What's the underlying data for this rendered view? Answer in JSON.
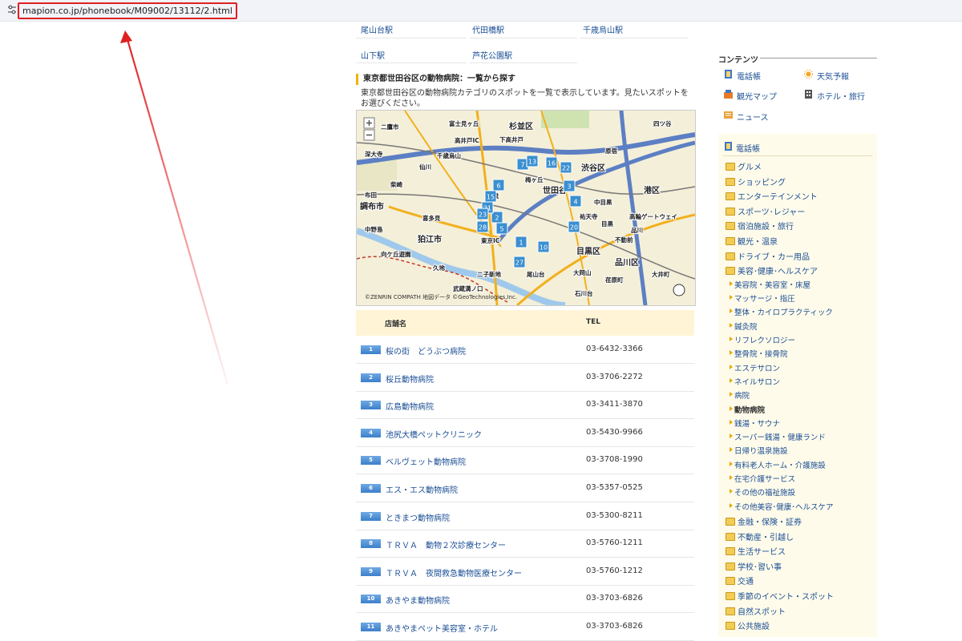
{
  "address_bar": {
    "url": "mapion.co.jp/phonebook/M09002/13112/2.html"
  },
  "stations": [
    {
      "label": "尾山台駅"
    },
    {
      "label": "代田橋駅"
    },
    {
      "label": "千歳烏山駅"
    },
    {
      "label": "山下駅"
    },
    {
      "label": "芦花公園駅"
    }
  ],
  "section": {
    "title": "東京都世田谷区の動物病院：一覧から探す",
    "description": "東京都世田谷区の動物病院カテゴリのスポットを一覧で表示しています。見たいスポットをお選びください。"
  },
  "map": {
    "copyright": "©ZENRIN COMPATH 地図データ ©GeoTechnologies,Inc.",
    "labels": [
      "二鷹市",
      "富士見ヶ丘",
      "杉並区",
      "四ツ谷",
      "高井戸IC",
      "深大寺",
      "千歳烏山",
      "下高井戸",
      "原宿",
      "仙川",
      "梅ヶ丘",
      "渋谷区",
      "柴崎",
      "千歳",
      "世田谷",
      "港区",
      "布田",
      "中目黒",
      "調布市",
      "喜多見",
      "祐天寺",
      "目黒",
      "中野島",
      "品川",
      "狛江市",
      "東京IC",
      "不動前",
      "向ケ丘遊園",
      "目黒区",
      "久地",
      "品川区",
      "二子新地",
      "尾山台",
      "大岡山",
      "武蔵溝ノ口",
      "荏原町",
      "石川台",
      "大井町",
      "高輪ゲートウェイ"
    ],
    "markers": [
      "1",
      "2",
      "3",
      "4",
      "5",
      "6",
      "7",
      "10",
      "13",
      "15",
      "16",
      "20",
      "21",
      "22",
      "23",
      "27",
      "28"
    ]
  },
  "table": {
    "header_name": "店舗名",
    "header_tel": "TEL",
    "rows": [
      {
        "num": "1",
        "name": "桜の街　どうぶつ病院",
        "tel": "03-6432-3366"
      },
      {
        "num": "2",
        "name": "桜丘動物病院",
        "tel": "03-3706-2272"
      },
      {
        "num": "3",
        "name": "広島動物病院",
        "tel": "03-3411-3870"
      },
      {
        "num": "4",
        "name": "池尻大橋ペットクリニック",
        "tel": "03-5430-9966"
      },
      {
        "num": "5",
        "name": "ベルヴェット動物病院",
        "tel": "03-3708-1990"
      },
      {
        "num": "6",
        "name": "エス・エス動物病院",
        "tel": "03-5357-0525"
      },
      {
        "num": "7",
        "name": "ときまつ動物病院",
        "tel": "03-5300-8211"
      },
      {
        "num": "8",
        "name": "ＴＲＶＡ　動物２次診療センター",
        "tel": "03-5760-1211"
      },
      {
        "num": "9",
        "name": "ＴＲＶＡ　夜間救急動物医療センター",
        "tel": "03-5760-1212"
      },
      {
        "num": "10",
        "name": "あきやま動物病院",
        "tel": "03-3703-6826"
      },
      {
        "num": "11",
        "name": "あきやまペット美容室・ホテル",
        "tel": "03-3703-6826"
      }
    ]
  },
  "contents": {
    "title": "コンテンツ",
    "links": [
      {
        "label": "電話帳",
        "icon": "phonebook-icon"
      },
      {
        "label": "天気予報",
        "icon": "sun-icon"
      },
      {
        "label": "観光マップ",
        "icon": "sightseeing-icon"
      },
      {
        "label": "ホテル・旅行",
        "icon": "hotel-icon"
      },
      {
        "label": "ニュース",
        "icon": "news-icon"
      }
    ]
  },
  "categories": {
    "title": "電話帳",
    "top": [
      "グルメ",
      "ショッピング",
      "エンターテインメント",
      "スポーツ･レジャー",
      "宿泊施設・旅行",
      "観光・温泉",
      "ドライブ・カー用品",
      "美容･健康･ヘルスケア"
    ],
    "sub": [
      "美容院・美容室・床屋",
      "マッサージ・指圧",
      "整体・カイロプラクティック",
      "鍼灸院",
      "リフレクソロジー",
      "整骨院・接骨院",
      "エステサロン",
      "ネイルサロン",
      "病院",
      "動物病院",
      "銭湯・サウナ",
      "スーパー銭湯・健康ランド",
      "日帰り温泉施設",
      "有料老人ホーム・介護施設",
      "在宅介護サービス",
      "その他の福祉施設",
      "その他美容･健康･ヘルスケア"
    ],
    "current": "動物病院",
    "rest": [
      "金融・保険・証券",
      "不動産・引越し",
      "生活サービス",
      "学校･習い事",
      "交通",
      "季節のイベント・スポット",
      "自然スポット",
      "公共施設"
    ]
  },
  "colors": {
    "link": "#1a4e95",
    "accent": "#f0b400",
    "badge": "#4b8ed6",
    "annotation": "#e02020"
  }
}
